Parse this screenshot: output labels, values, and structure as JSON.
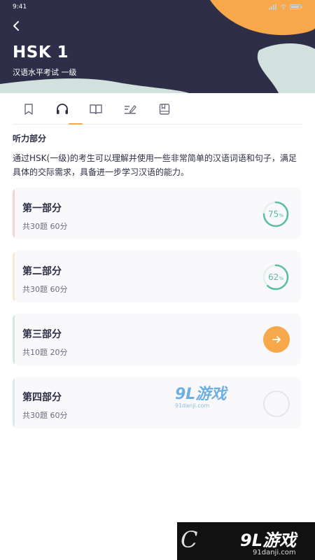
{
  "status_bar": {
    "time": "9:41"
  },
  "header": {
    "title": "HSK 1",
    "subtitle": "汉语水平考试 一级"
  },
  "tabs": [
    {
      "icon": "bookmark-icon"
    },
    {
      "icon": "headphones-icon",
      "active": true
    },
    {
      "icon": "open-book-icon"
    },
    {
      "icon": "writing-icon"
    },
    {
      "icon": "notebook-icon"
    }
  ],
  "section": {
    "title": "听力部分",
    "description": "通过HSK(一级)的考生可以理解并使用一些非常简单的汉语词语和句子，满足具体的交际需求，具备进一步学习汉语的能力。"
  },
  "parts": [
    {
      "name": "第一部分",
      "meta": "共30题 60分",
      "progress": 75,
      "progress_unit": "%",
      "accent": "#f6d3d3"
    },
    {
      "name": "第二部分",
      "meta": "共30题 60分",
      "progress": 62,
      "progress_unit": "%",
      "accent": "#fbe8cc"
    },
    {
      "name": "第三部分",
      "meta": "共10题 20分",
      "state": "start",
      "accent": "#cfeadf"
    },
    {
      "name": "第四部分",
      "meta": "共30题 60分",
      "state": "not-started",
      "accent": "#d5ece9"
    }
  ],
  "watermark": {
    "brand": "9L游戏",
    "url": "91danji.com"
  },
  "colors": {
    "header_bg": "#2e2e48",
    "accent_orange": "#f6a84a",
    "progress_green": "#5bbd9f"
  }
}
